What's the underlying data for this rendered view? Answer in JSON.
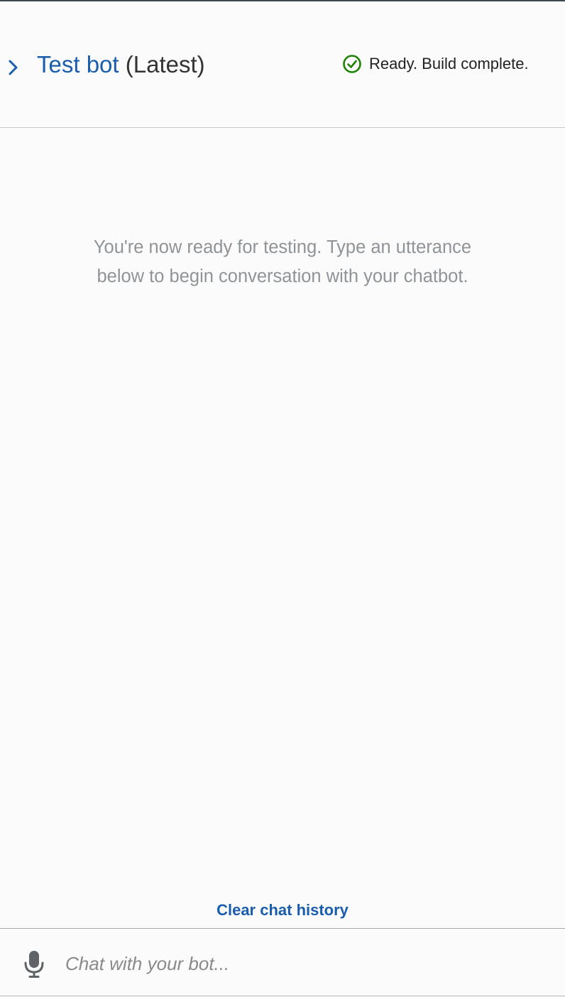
{
  "header": {
    "title_link": "Test bot",
    "title_suffix": " (Latest)",
    "status_text": "Ready. Build complete.",
    "status_icon": "check-circle-icon",
    "collapse_icon": "chevron-right-icon"
  },
  "main": {
    "intro_line1": "You're now ready for testing. Type an utterance",
    "intro_line2": "below to begin conversation with your chatbot."
  },
  "footer": {
    "clear_label": "Clear chat history",
    "mic_icon": "microphone-icon",
    "input_value": "",
    "input_placeholder": "Chat with your bot..."
  },
  "colors": {
    "link": "#1a5dad",
    "success": "#1d8102",
    "muted_text": "#8f9498"
  }
}
